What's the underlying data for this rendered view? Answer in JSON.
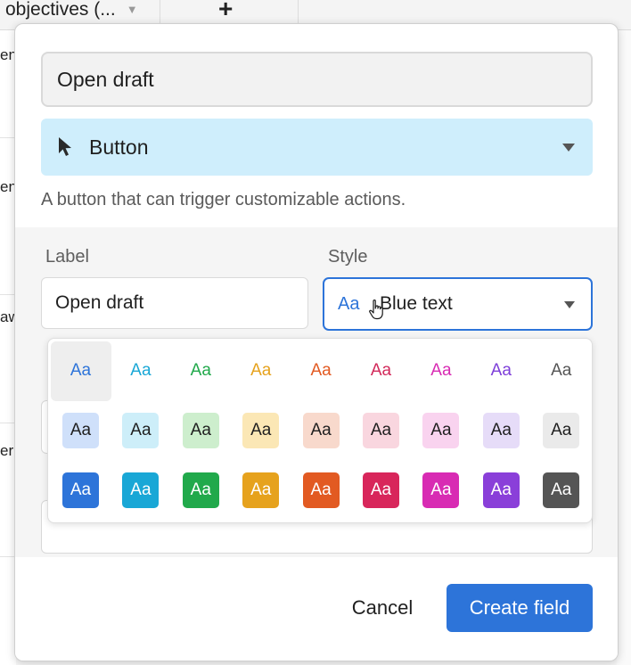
{
  "background": {
    "column_title": "objectives (...",
    "add_column_symbol": "+",
    "left_row_fragments": [
      "en",
      "en",
      "aw",
      "er"
    ]
  },
  "modal": {
    "field_name_value": "Open draft",
    "field_type": {
      "icon": "cursor-arrow-icon",
      "label": "Button"
    },
    "description": "A button that can trigger customizable actions.",
    "label_field": {
      "label": "Label",
      "value": "Open draft"
    },
    "style_field": {
      "label": "Style",
      "preview": "Aa",
      "value": "Blue text"
    },
    "swatches": {
      "sample_text": "Aa",
      "rows": [
        {
          "kind": "text",
          "colors": [
            "#2d74d9",
            "#19a7d6",
            "#21a94b",
            "#e6a21d",
            "#e25a22",
            "#d2295a",
            "#d82bb3",
            "#7e3fd9",
            "#555555"
          ]
        },
        {
          "kind": "light",
          "bg": [
            "#cfe0fa",
            "#cdeef9",
            "#cdeecd",
            "#fbe7b5",
            "#f8d9cc",
            "#f9d6df",
            "#f9d3ef",
            "#e6dcf8",
            "#eaeaea"
          ],
          "fg": "#1f1f1f"
        },
        {
          "kind": "solid",
          "bg": [
            "#2d74d9",
            "#19a7d6",
            "#21a94b",
            "#e6a21d",
            "#e25a22",
            "#d8265b",
            "#d82bb3",
            "#8a3fd9",
            "#555555"
          ],
          "fg": "#ffffff"
        }
      ],
      "selected_index": 0
    },
    "footer": {
      "cancel_label": "Cancel",
      "create_label": "Create field"
    }
  },
  "colors": {
    "accent": "#2d74d9",
    "type_select_bg": "#cfeefc"
  }
}
